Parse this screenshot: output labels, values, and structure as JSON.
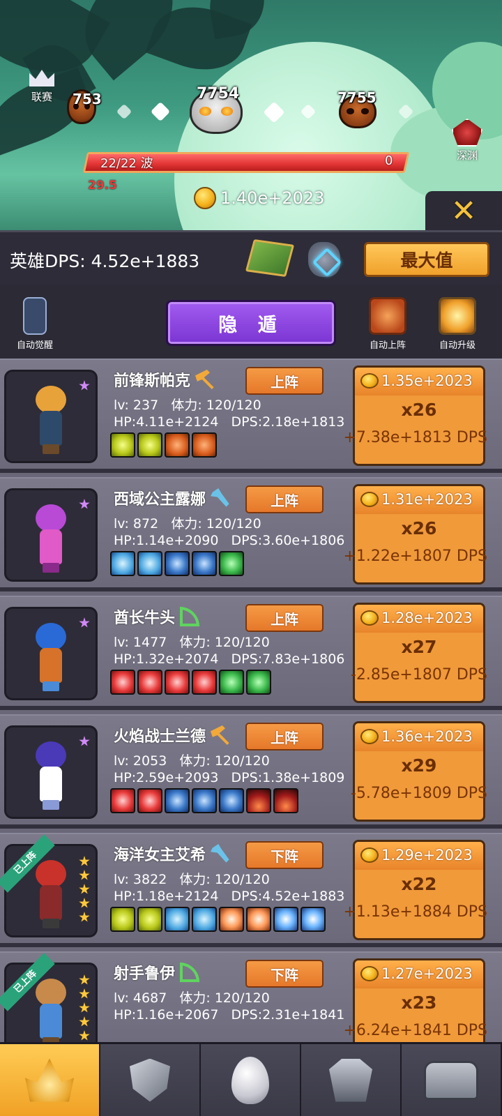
{
  "top": {
    "league_label": "联赛",
    "abyss_label": "深渊",
    "skull_prev": "753",
    "skull_current": "7754",
    "skull_next": "7755",
    "wave_text": "22/22 波",
    "wave_right": "0",
    "wave_progress": 1.0,
    "timer": "29.5",
    "gold": "1.40e+2023",
    "close_label": "✕"
  },
  "dps_header": {
    "dps_text": "英雄DPS: 4.52e+1883",
    "max_label": "最大值"
  },
  "controls": {
    "auto_awaken": "自动觉醒",
    "hide_label": "隐 遁",
    "auto_deploy": "自动上阵",
    "auto_upgrade": "自动升级"
  },
  "heroes": [
    {
      "name": "前锋斯帕克",
      "role_icon": "hammer-icon",
      "button": "上阵",
      "lv": "lv: 237",
      "stamina": "体力: 120/120",
      "hp": "HP:4.11e+2124",
      "dps": "DPS:2.18e+1813",
      "cost": "1.35e+2023",
      "mult": "x26",
      "dps_gain": "+7.38e+1813 DPS",
      "deployed": false,
      "star_type": "purple",
      "skills": [
        "yellow",
        "yellow",
        "orange",
        "orange"
      ],
      "chibi": {
        "hair": "#e8a23a",
        "body": "#2e4a6a",
        "legs": "#6a4a2a"
      }
    },
    {
      "name": "西域公主露娜",
      "role_icon": "wrench-icon",
      "button": "上阵",
      "lv": "lv: 872",
      "stamina": "体力: 120/120",
      "hp": "HP:1.14e+2090",
      "dps": "DPS:3.60e+1806",
      "cost": "1.31e+2023",
      "mult": "x26",
      "dps_gain": "+1.22e+1807 DPS",
      "deployed": false,
      "star_type": "purple",
      "skills": [
        "ice",
        "ice",
        "blue",
        "blue",
        "green"
      ],
      "chibi": {
        "hair": "#b84ad6",
        "body": "#e05ac8",
        "legs": "#8a2a8a"
      }
    },
    {
      "name": "酋长牛头",
      "role_icon": "bow-icon",
      "button": "上阵",
      "lv": "lv: 1477",
      "stamina": "体力: 120/120",
      "hp": "HP:1.32e+2074",
      "dps": "DPS:7.83e+1806",
      "cost": "1.28e+2023",
      "mult": "x27",
      "dps_gain": "-2.85e+1807 DPS",
      "deployed": false,
      "star_type": "purple",
      "skills": [
        "red",
        "red",
        "red",
        "red",
        "green",
        "green"
      ],
      "chibi": {
        "hair": "#2a6ad6",
        "body": "#d6722a",
        "legs": "#4a8ad6"
      }
    },
    {
      "name": "火焰战士兰德",
      "role_icon": "hammer-icon",
      "button": "上阵",
      "lv": "lv: 2053",
      "stamina": "体力: 120/120",
      "hp": "HP:2.59e+2093",
      "dps": "DPS:1.38e+1809",
      "cost": "1.36e+2023",
      "mult": "x29",
      "dps_gain": "-5.78e+1809 DPS",
      "deployed": false,
      "star_type": "purple",
      "skills": [
        "red",
        "red",
        "blue",
        "blue",
        "blue",
        "drop",
        "drop"
      ],
      "chibi": {
        "hair": "#4a3ab8",
        "body": "#ffffff",
        "legs": "#8a9ad6"
      }
    },
    {
      "name": "海洋女主艾希",
      "role_icon": "wrench-icon",
      "button": "下阵",
      "lv": "lv: 3822",
      "stamina": "体力: 120/120",
      "hp": "HP:1.18e+2124",
      "dps": "DPS:4.52e+1883",
      "cost": "1.29e+2023",
      "mult": "x22",
      "dps_gain": "+1.13e+1884 DPS",
      "deployed": true,
      "ribbon": "已上阵",
      "star_type": "gold",
      "skills": [
        "yellow",
        "yellow",
        "ice",
        "ice",
        "cat",
        "cat",
        "blue-ice",
        "blue-ice"
      ],
      "chibi": {
        "hair": "#c8322a",
        "body": "#8a2a2a",
        "legs": "#3a3a3a"
      }
    },
    {
      "name": "射手鲁伊",
      "role_icon": "bow-icon",
      "button": "下阵",
      "lv": "lv: 4687",
      "stamina": "体力: 120/120",
      "hp": "HP:1.16e+2067",
      "dps": "DPS:2.31e+1841",
      "cost": "1.27e+2023",
      "mult": "x23",
      "dps_gain": "+6.24e+1841 DPS",
      "deployed": true,
      "ribbon": "已上阵",
      "star_type": "gold",
      "skills": [],
      "chibi": {
        "hair": "#c88a4a",
        "body": "#4a8ad6",
        "legs": "#6a4a2a"
      }
    }
  ],
  "nav": [
    "crown-helmet-icon",
    "shield-sword-icon",
    "egg-icon",
    "armor-icon",
    "treasure-chest-icon"
  ]
}
